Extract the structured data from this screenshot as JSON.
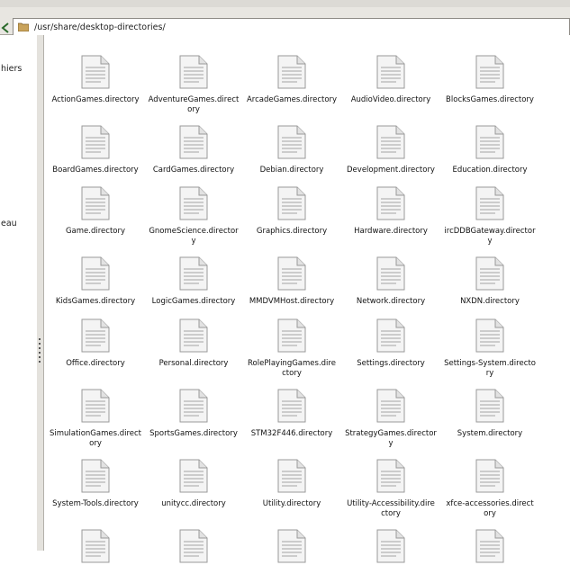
{
  "location": {
    "path": "/usr/share/desktop-directories/"
  },
  "sidebar": {
    "labels": [
      "hiers",
      "eau"
    ]
  },
  "files": [
    "ActionGames.directory",
    "AdventureGames.directory",
    "ArcadeGames.directory",
    "AudioVideo.directory",
    "BlocksGames.directory",
    "BoardGames.directory",
    "CardGames.directory",
    "Debian.directory",
    "Development.directory",
    "Education.directory",
    "Game.directory",
    "GnomeScience.directory",
    "Graphics.directory",
    "Hardware.directory",
    "ircDDBGateway.directory",
    "KidsGames.directory",
    "LogicGames.directory",
    "MMDVMHost.directory",
    "Network.directory",
    "NXDN.directory",
    "Office.directory",
    "Personal.directory",
    "RolePlayingGames.directory",
    "Settings.directory",
    "Settings-System.directory",
    "SimulationGames.directory",
    "SportsGames.directory",
    "STM32F446.directory",
    "StrategyGames.directory",
    "System.directory",
    "System-Tools.directory",
    "unitycc.directory",
    "Utility.directory",
    "Utility-Accessibility.directory",
    "xfce-accessories.directory",
    "",
    "",
    "",
    "",
    ""
  ]
}
